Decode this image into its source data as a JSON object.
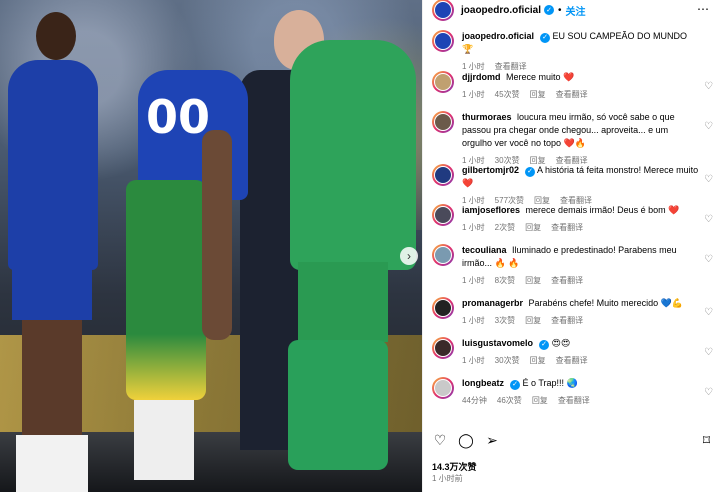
{
  "header": {
    "username": "joaopedro.oficial",
    "separator": "•",
    "follow_label": "关注",
    "more_label": "⋯"
  },
  "photo": {
    "jersey_number": "00"
  },
  "caption": {
    "username": "joaopedro.oficial",
    "text": "EU SOU CAMPEÃO DO MUNDO 🏆",
    "time": "1 小时",
    "translate": "查看翻译"
  },
  "comments": [
    {
      "user": "djjrdomd",
      "verified": false,
      "text": "Merece muito ❤️",
      "time": "1 小时",
      "likes": "45次赞",
      "reply": "回复",
      "translate": "查看翻译"
    },
    {
      "user": "thurmoraes",
      "verified": false,
      "text": "loucura meu irmão, só você sabe o que passou pra chegar onde chegou... aproveita... e um orgulho ver você no topo ❤️🔥",
      "time": "1 小时",
      "likes": "30次赞",
      "reply": "回复",
      "translate": "查看翻译"
    },
    {
      "user": "gilbertomjr02",
      "verified": true,
      "text": "A história tá feita monstro! Merece muito ❤️",
      "time": "1 小时",
      "likes": "577次赞",
      "reply": "回复",
      "translate": "查看翻译"
    },
    {
      "user": "iamjoseflores",
      "verified": false,
      "text": "merece demais irmão! Deus é bom ❤️",
      "time": "1 小时",
      "likes": "2次赞",
      "reply": "回复",
      "translate": "查看翻译"
    },
    {
      "user": "tecouliana",
      "verified": false,
      "text": "Iluminado e predestinado! Parabens meu irmão... 🔥 🔥",
      "time": "1 小时",
      "likes": "8次赞",
      "reply": "回复",
      "translate": "查看翻译"
    },
    {
      "user": "promanagerbr",
      "verified": false,
      "text": "Parabéns chefe! Muito merecido 💙💪",
      "time": "1 小时",
      "likes": "3次赞",
      "reply": "回复",
      "translate": "查看翻译"
    },
    {
      "user": "luisgustavomelo",
      "verified": true,
      "text": "😍😍",
      "time": "1 小时",
      "likes": "30次赞",
      "reply": "回复",
      "translate": "查看翻译"
    },
    {
      "user": "longbeatz",
      "verified": true,
      "text": "É o Trap!!! 🌏",
      "time": "44分钟",
      "likes": "46次赞",
      "reply": "回复",
      "translate": "查看翻译"
    }
  ],
  "actions": {
    "like_icon": "heart-icon",
    "comment_icon": "comment-icon",
    "share_icon": "share-icon",
    "save_icon": "bookmark-icon"
  },
  "likes_count": "14.3万次赞",
  "posted_time": "1 小时前",
  "colors": {
    "accent": "#0095f6",
    "muted": "#737373",
    "heart": "#ff3040"
  }
}
